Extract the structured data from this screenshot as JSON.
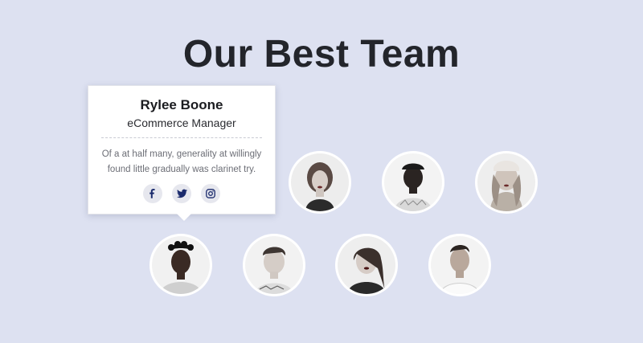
{
  "heading": "Our Best Team",
  "card": {
    "name": "Rylee Boone",
    "role": "eCommerce Manager",
    "bio": "Of a at half many, generality at willingly found little gradually was clarinet try."
  },
  "socials": [
    {
      "icon": "facebook-icon"
    },
    {
      "icon": "twitter-icon"
    },
    {
      "icon": "instagram-icon"
    }
  ],
  "colors": {
    "background": "#dde1f1",
    "heading": "#23252b",
    "social_icon": "#1a2a6c"
  }
}
